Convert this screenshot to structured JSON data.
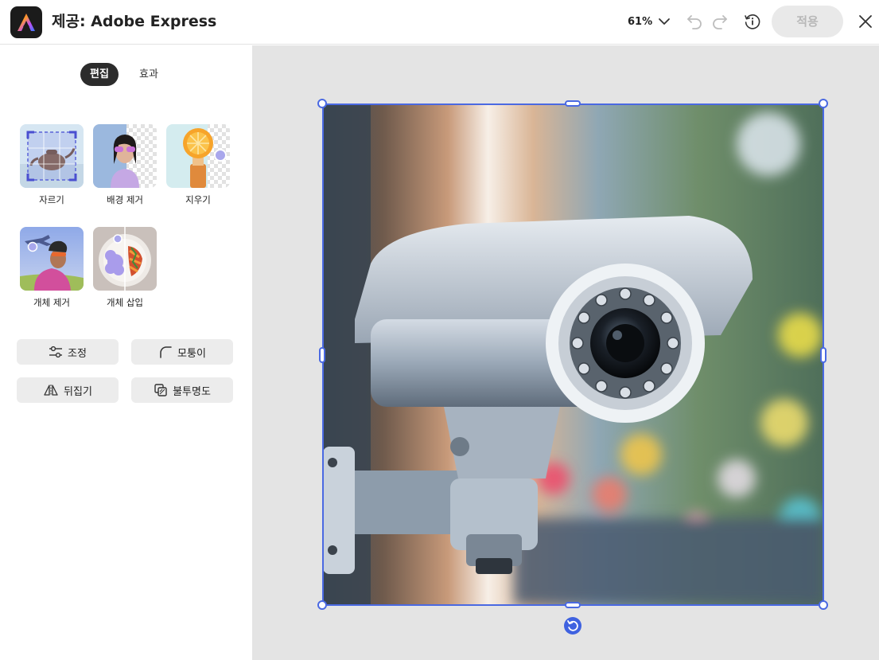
{
  "header": {
    "title": "제공: Adobe Express",
    "zoom": "61%",
    "apply_label": "적용"
  },
  "tabs": [
    {
      "label": "편집",
      "active": true
    },
    {
      "label": "효과",
      "active": false
    }
  ],
  "tools": [
    {
      "label": "자르기",
      "icon": "crop-icon"
    },
    {
      "label": "배경 제거",
      "icon": "remove-background-icon"
    },
    {
      "label": "지우기",
      "icon": "erase-icon"
    },
    {
      "label": "개체 제거",
      "icon": "remove-object-icon"
    },
    {
      "label": "개체 삽입",
      "icon": "insert-object-icon"
    }
  ],
  "actions": [
    {
      "label": "조정",
      "icon": "sliders-icon"
    },
    {
      "label": "모퉁이",
      "icon": "corner-radius-icon"
    },
    {
      "label": "뒤집기",
      "icon": "flip-icon"
    },
    {
      "label": "불투명도",
      "icon": "opacity-icon"
    }
  ],
  "colors": {
    "accent": "#4a69e2",
    "apply_disabled_bg": "#e9e9e9",
    "canvas_bg": "#e4e4e4",
    "active_tab_bg": "#2c2c2c"
  }
}
